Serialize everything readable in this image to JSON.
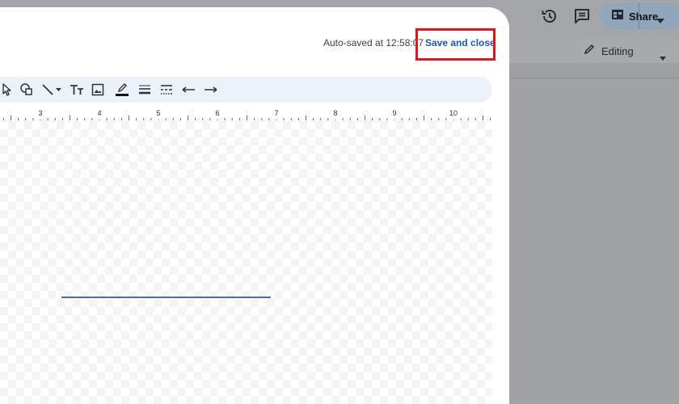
{
  "header": {
    "share_label": "Share",
    "editing_label": "Editing"
  },
  "dialog": {
    "autosave_text": "Auto-saved at 12:58:07",
    "save_close_label": "Save and close",
    "highlight_color": "#d71920",
    "link_color": "#1a56b8"
  },
  "toolbar": {
    "icons": [
      "select-icon",
      "shape-icon",
      "line-icon",
      "line-dropdown-icon",
      "text-box-icon",
      "image-icon",
      "line-color-icon",
      "line-weight-icon",
      "line-dash-icon",
      "line-start-icon",
      "line-end-icon"
    ]
  },
  "ruler": {
    "ticks": [
      "3",
      "4",
      "5",
      "6",
      "7",
      "8",
      "9",
      "10"
    ]
  },
  "canvas": {
    "line_color": "#4a6fa5"
  }
}
